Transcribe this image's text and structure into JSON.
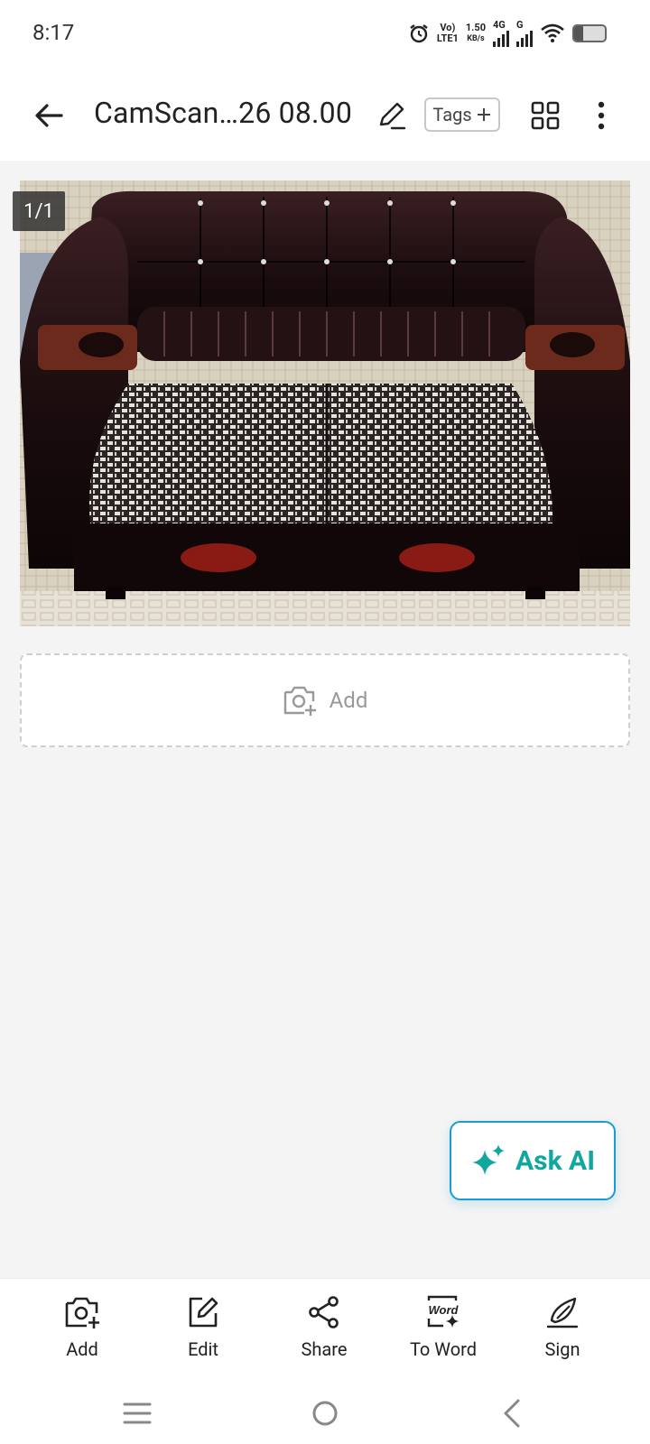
{
  "status_bar": {
    "time": "8:17",
    "volte_line1": "Vo)",
    "volte_line2": "LTE1",
    "speed_value": "1.50",
    "speed_unit": "KB/s",
    "network_1": "4G",
    "network_2": "G"
  },
  "header": {
    "title": "CamScan…26 08.00",
    "tags_label": "Tags"
  },
  "page": {
    "counter": "1/1"
  },
  "add_area": {
    "label": "Add"
  },
  "ask_ai": {
    "label": "Ask AI"
  },
  "toolbar": {
    "items": [
      {
        "label": "Add",
        "icon": "camera-add-icon"
      },
      {
        "label": "Edit",
        "icon": "edit-icon"
      },
      {
        "label": "Share",
        "icon": "share-icon"
      },
      {
        "label": "To Word",
        "icon": "word-icon"
      },
      {
        "label": "Sign",
        "icon": "sign-icon"
      }
    ],
    "word_icon_text": "Word"
  },
  "colors": {
    "accent_ai": "#12a6a0",
    "ask_ai_border": "#1a9bd6"
  }
}
